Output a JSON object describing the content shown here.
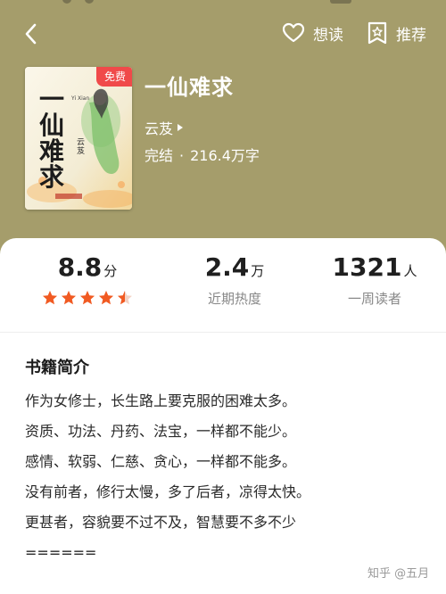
{
  "nav": {
    "want_read_label": "想读",
    "recommend_label": "推荐",
    "icons": [
      "back-arrow-icon",
      "heart-icon",
      "star-badge-icon"
    ]
  },
  "book": {
    "title": "一仙难求",
    "author": "云芨",
    "status": "完结",
    "word_count": "216.4万字",
    "free_tag": "免费",
    "cover_title": "一仙难求",
    "cover_author": "云芨",
    "cover_sub": "Yi Xian"
  },
  "stats": {
    "rating": {
      "value": "8.8",
      "unit": "分",
      "stars": 4.5
    },
    "heat": {
      "value": "2.4",
      "unit": "万",
      "label": "近期热度"
    },
    "readers": {
      "value": "1321",
      "unit": "人",
      "label": "一周读者"
    }
  },
  "intro": {
    "heading": "书籍简介",
    "lines": [
      "作为女修士，长生路上要克服的困难太多。",
      "资质、功法、丹药、法宝，一样都不能少。",
      "感情、软弱、仁慈、贪心，一样都不能多。",
      "没有前者，修行太慢，多了后者，凉得太快。",
      "更甚者，容貌要不过不及，智慧要不多不少",
      "======"
    ]
  },
  "watermark": "知乎 @五月",
  "colors": {
    "header_bg": "#a59d6b",
    "star": "#f15a22",
    "free_tag": "#f04a4a"
  }
}
